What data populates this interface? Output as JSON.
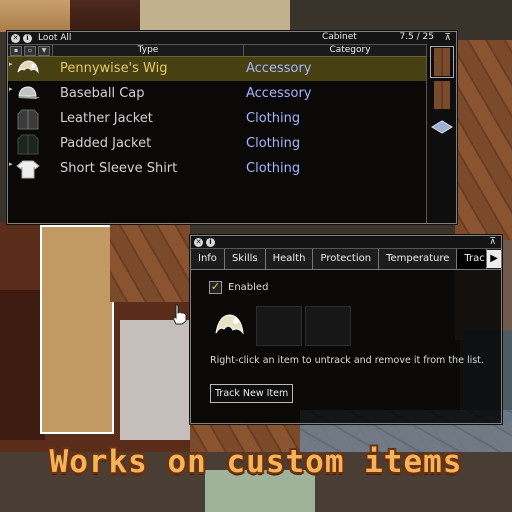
{
  "loot_window": {
    "loot_all_label": "Loot All",
    "container_name": "Cabinet",
    "capacity": "7.5 / 25",
    "columns": {
      "type": "Type",
      "category": "Category"
    },
    "items": [
      {
        "name": "Pennywise's Wig",
        "category": "Accessory",
        "icon": "wig-icon",
        "selected": true
      },
      {
        "name": "Baseball Cap",
        "category": "Accessory",
        "icon": "cap-icon",
        "selected": false
      },
      {
        "name": "Leather Jacket",
        "category": "Clothing",
        "icon": "leather-jacket-icon",
        "selected": false
      },
      {
        "name": "Padded Jacket",
        "category": "Clothing",
        "icon": "padded-jacket-icon",
        "selected": false
      },
      {
        "name": "Short Sleeve Shirt",
        "category": "Clothing",
        "icon": "shirt-icon",
        "selected": false
      }
    ],
    "side_containers": [
      "cabinet-icon",
      "cabinet-icon",
      "floor-tile-icon"
    ]
  },
  "info_window": {
    "tabs": [
      {
        "label": "Info",
        "active": false
      },
      {
        "label": "Skills",
        "active": false
      },
      {
        "label": "Health",
        "active": false
      },
      {
        "label": "Protection",
        "active": false
      },
      {
        "label": "Temperature",
        "active": false
      },
      {
        "label": "Trac",
        "active": true
      }
    ],
    "enabled_label": "Enabled",
    "enabled_checked": true,
    "tracked_items": [
      "wig-icon"
    ],
    "hint": "Right-click an item to untrack and remove it from the list.",
    "track_button": "Track New Item"
  },
  "caption": "Works on custom items",
  "colors": {
    "selected_row": "#786e1e",
    "category_text": "#a9b5ff",
    "caption": "#f6b45a"
  }
}
